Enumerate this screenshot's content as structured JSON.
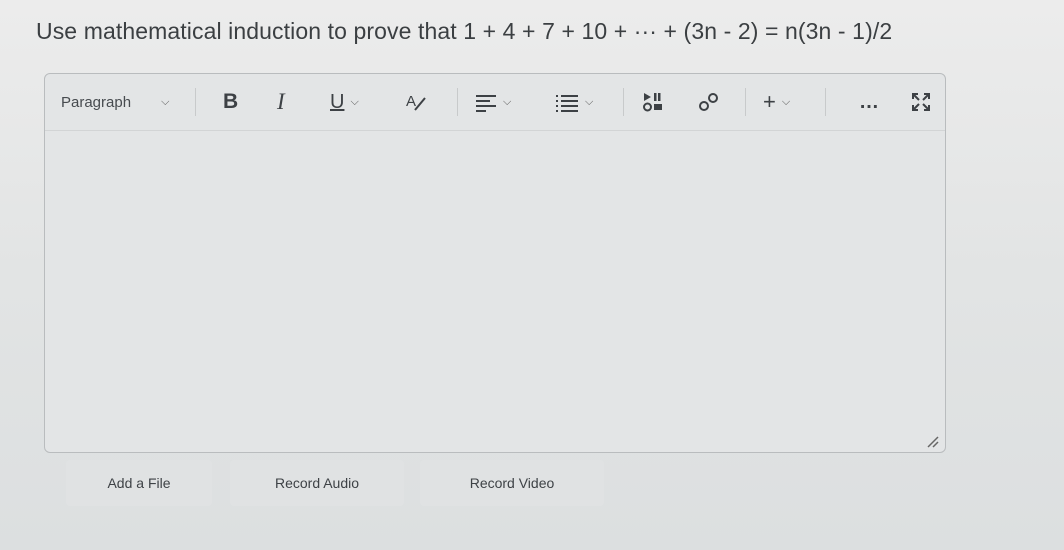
{
  "question": "Use mathematical induction to prove that 1 + 4 + 7 + 10 + ··· + (3n - 2) = n(3n - 1)/2",
  "toolbar": {
    "paragraph_label": "Paragraph",
    "bold": "B",
    "italic": "I",
    "underline": "U",
    "more": "…",
    "insert": "+"
  },
  "buttons": {
    "add_file": "Add a File",
    "record_audio": "Record Audio",
    "record_video": "Record Video"
  }
}
